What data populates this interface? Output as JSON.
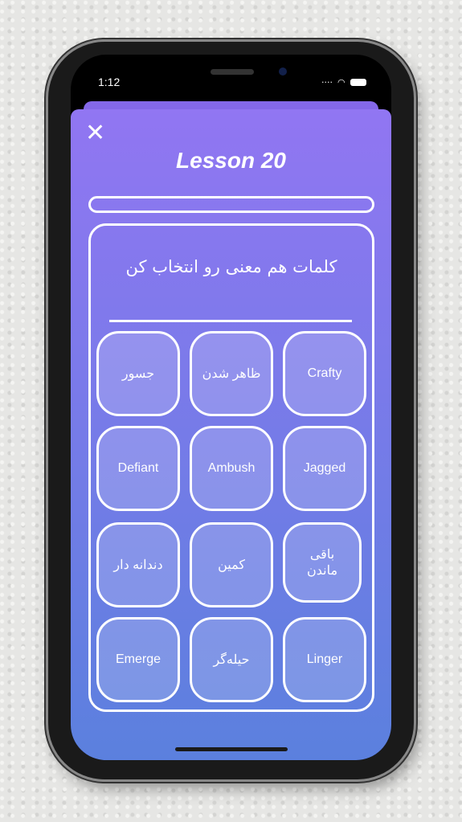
{
  "status_bar": {
    "time": "1:12",
    "signal_icon": "dots-icon",
    "wifi_icon": "wifi-icon",
    "battery_icon": "battery-icon"
  },
  "header": {
    "close_icon": "close-icon",
    "close_glyph": "✕",
    "title": "Lesson 20"
  },
  "progress": {
    "value": 0
  },
  "question": "کلمات هم معنی رو انتخاب کن",
  "tiles": [
    "جسور",
    "ظاهر شدن",
    "Crafty",
    "Defiant",
    "Ambush",
    "Jagged",
    "دندانه دار",
    "کمین",
    "باقی ماندن",
    "Emerge",
    "حیله‌گر",
    "Linger"
  ],
  "colors": {
    "gradient_top": "#9176f2",
    "gradient_bottom": "#5b80de"
  }
}
